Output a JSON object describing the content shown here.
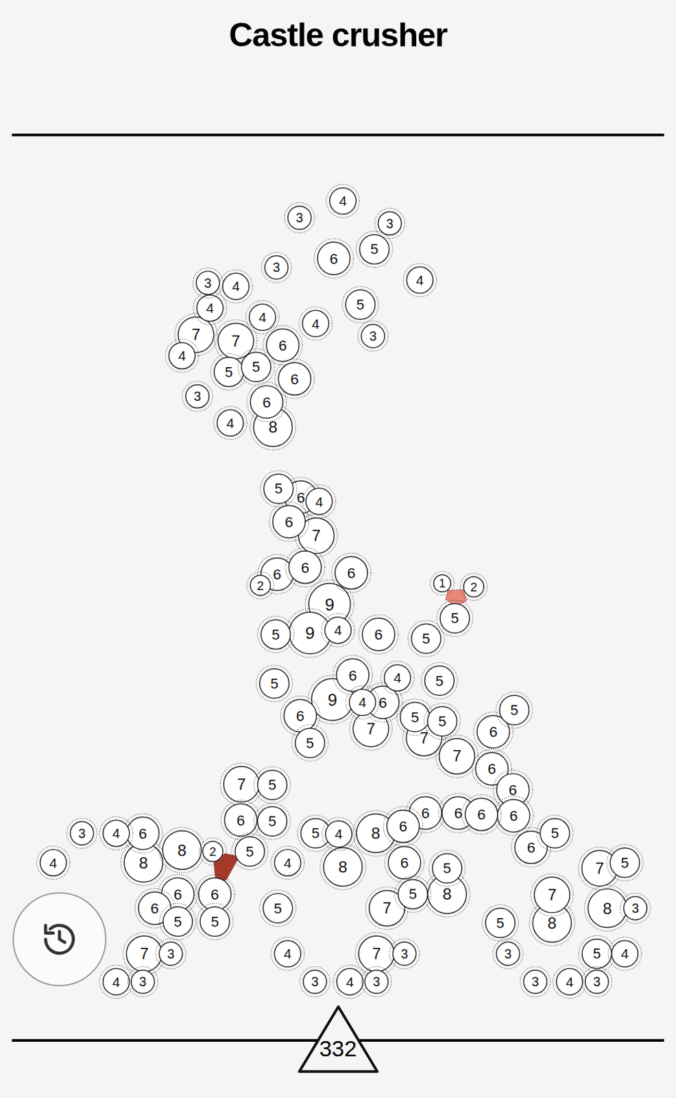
{
  "title": "Castle crusher",
  "score": "332",
  "shapes": [
    {
      "color": "#a63a2a"
    },
    {
      "color": "#e8877a"
    }
  ],
  "circles": [
    {
      "value": "4"
    },
    {
      "value": "3"
    },
    {
      "value": "3"
    },
    {
      "value": "5"
    },
    {
      "value": "6"
    },
    {
      "value": "3"
    },
    {
      "value": "4"
    },
    {
      "value": "5"
    },
    {
      "value": "3"
    },
    {
      "value": "4"
    },
    {
      "value": "3"
    },
    {
      "value": "4"
    },
    {
      "value": "4"
    },
    {
      "value": "7"
    },
    {
      "value": "7"
    },
    {
      "value": "4"
    },
    {
      "value": "6"
    },
    {
      "value": "4"
    },
    {
      "value": "5"
    },
    {
      "value": "5"
    },
    {
      "value": "6"
    },
    {
      "value": "3"
    },
    {
      "value": "6"
    },
    {
      "value": "4"
    },
    {
      "value": "8"
    },
    {
      "value": "5"
    },
    {
      "value": "6"
    },
    {
      "value": "4"
    },
    {
      "value": "6"
    },
    {
      "value": "7"
    },
    {
      "value": "6"
    },
    {
      "value": "2"
    },
    {
      "value": "6"
    },
    {
      "value": "6"
    },
    {
      "value": "9"
    },
    {
      "value": "5"
    },
    {
      "value": "9"
    },
    {
      "value": "4"
    },
    {
      "value": "6"
    },
    {
      "value": "5"
    },
    {
      "value": "1"
    },
    {
      "value": "2"
    },
    {
      "value": "5"
    },
    {
      "value": "5"
    },
    {
      "value": "6"
    },
    {
      "value": "4"
    },
    {
      "value": "5"
    },
    {
      "value": "9"
    },
    {
      "value": "4"
    },
    {
      "value": "6"
    },
    {
      "value": "5"
    },
    {
      "value": "5"
    },
    {
      "value": "7"
    },
    {
      "value": "7"
    },
    {
      "value": "7"
    },
    {
      "value": "6"
    },
    {
      "value": "5"
    },
    {
      "value": "6"
    },
    {
      "value": "5"
    },
    {
      "value": "7"
    },
    {
      "value": "5"
    },
    {
      "value": "6"
    },
    {
      "value": "5"
    },
    {
      "value": "6"
    },
    {
      "value": "6"
    },
    {
      "value": "6"
    },
    {
      "value": "6"
    },
    {
      "value": "6"
    },
    {
      "value": "6"
    },
    {
      "value": "5"
    },
    {
      "value": "4"
    },
    {
      "value": "8"
    },
    {
      "value": "6"
    },
    {
      "value": "6"
    },
    {
      "value": "2"
    },
    {
      "value": "5"
    },
    {
      "value": "6"
    },
    {
      "value": "5"
    },
    {
      "value": "4"
    },
    {
      "value": "8"
    },
    {
      "value": "5"
    },
    {
      "value": "8"
    },
    {
      "value": "5"
    },
    {
      "value": "7"
    },
    {
      "value": "7"
    },
    {
      "value": "3"
    },
    {
      "value": "5"
    },
    {
      "value": "4"
    },
    {
      "value": "3"
    },
    {
      "value": "4"
    },
    {
      "value": "3"
    },
    {
      "value": "3"
    },
    {
      "value": "4"
    },
    {
      "value": "6"
    },
    {
      "value": "8"
    },
    {
      "value": "8"
    },
    {
      "value": "4"
    },
    {
      "value": "6"
    },
    {
      "value": "6"
    },
    {
      "value": "5"
    },
    {
      "value": "7"
    },
    {
      "value": "3"
    },
    {
      "value": "4"
    },
    {
      "value": "3"
    },
    {
      "value": "6"
    },
    {
      "value": "5"
    },
    {
      "value": "5"
    },
    {
      "value": "7"
    },
    {
      "value": "7"
    },
    {
      "value": "8"
    },
    {
      "value": "3"
    },
    {
      "value": "8"
    },
    {
      "value": "5"
    },
    {
      "value": "3"
    },
    {
      "value": "5"
    },
    {
      "value": "4"
    },
    {
      "value": "3"
    },
    {
      "value": "4"
    },
    {
      "value": "3"
    }
  ]
}
